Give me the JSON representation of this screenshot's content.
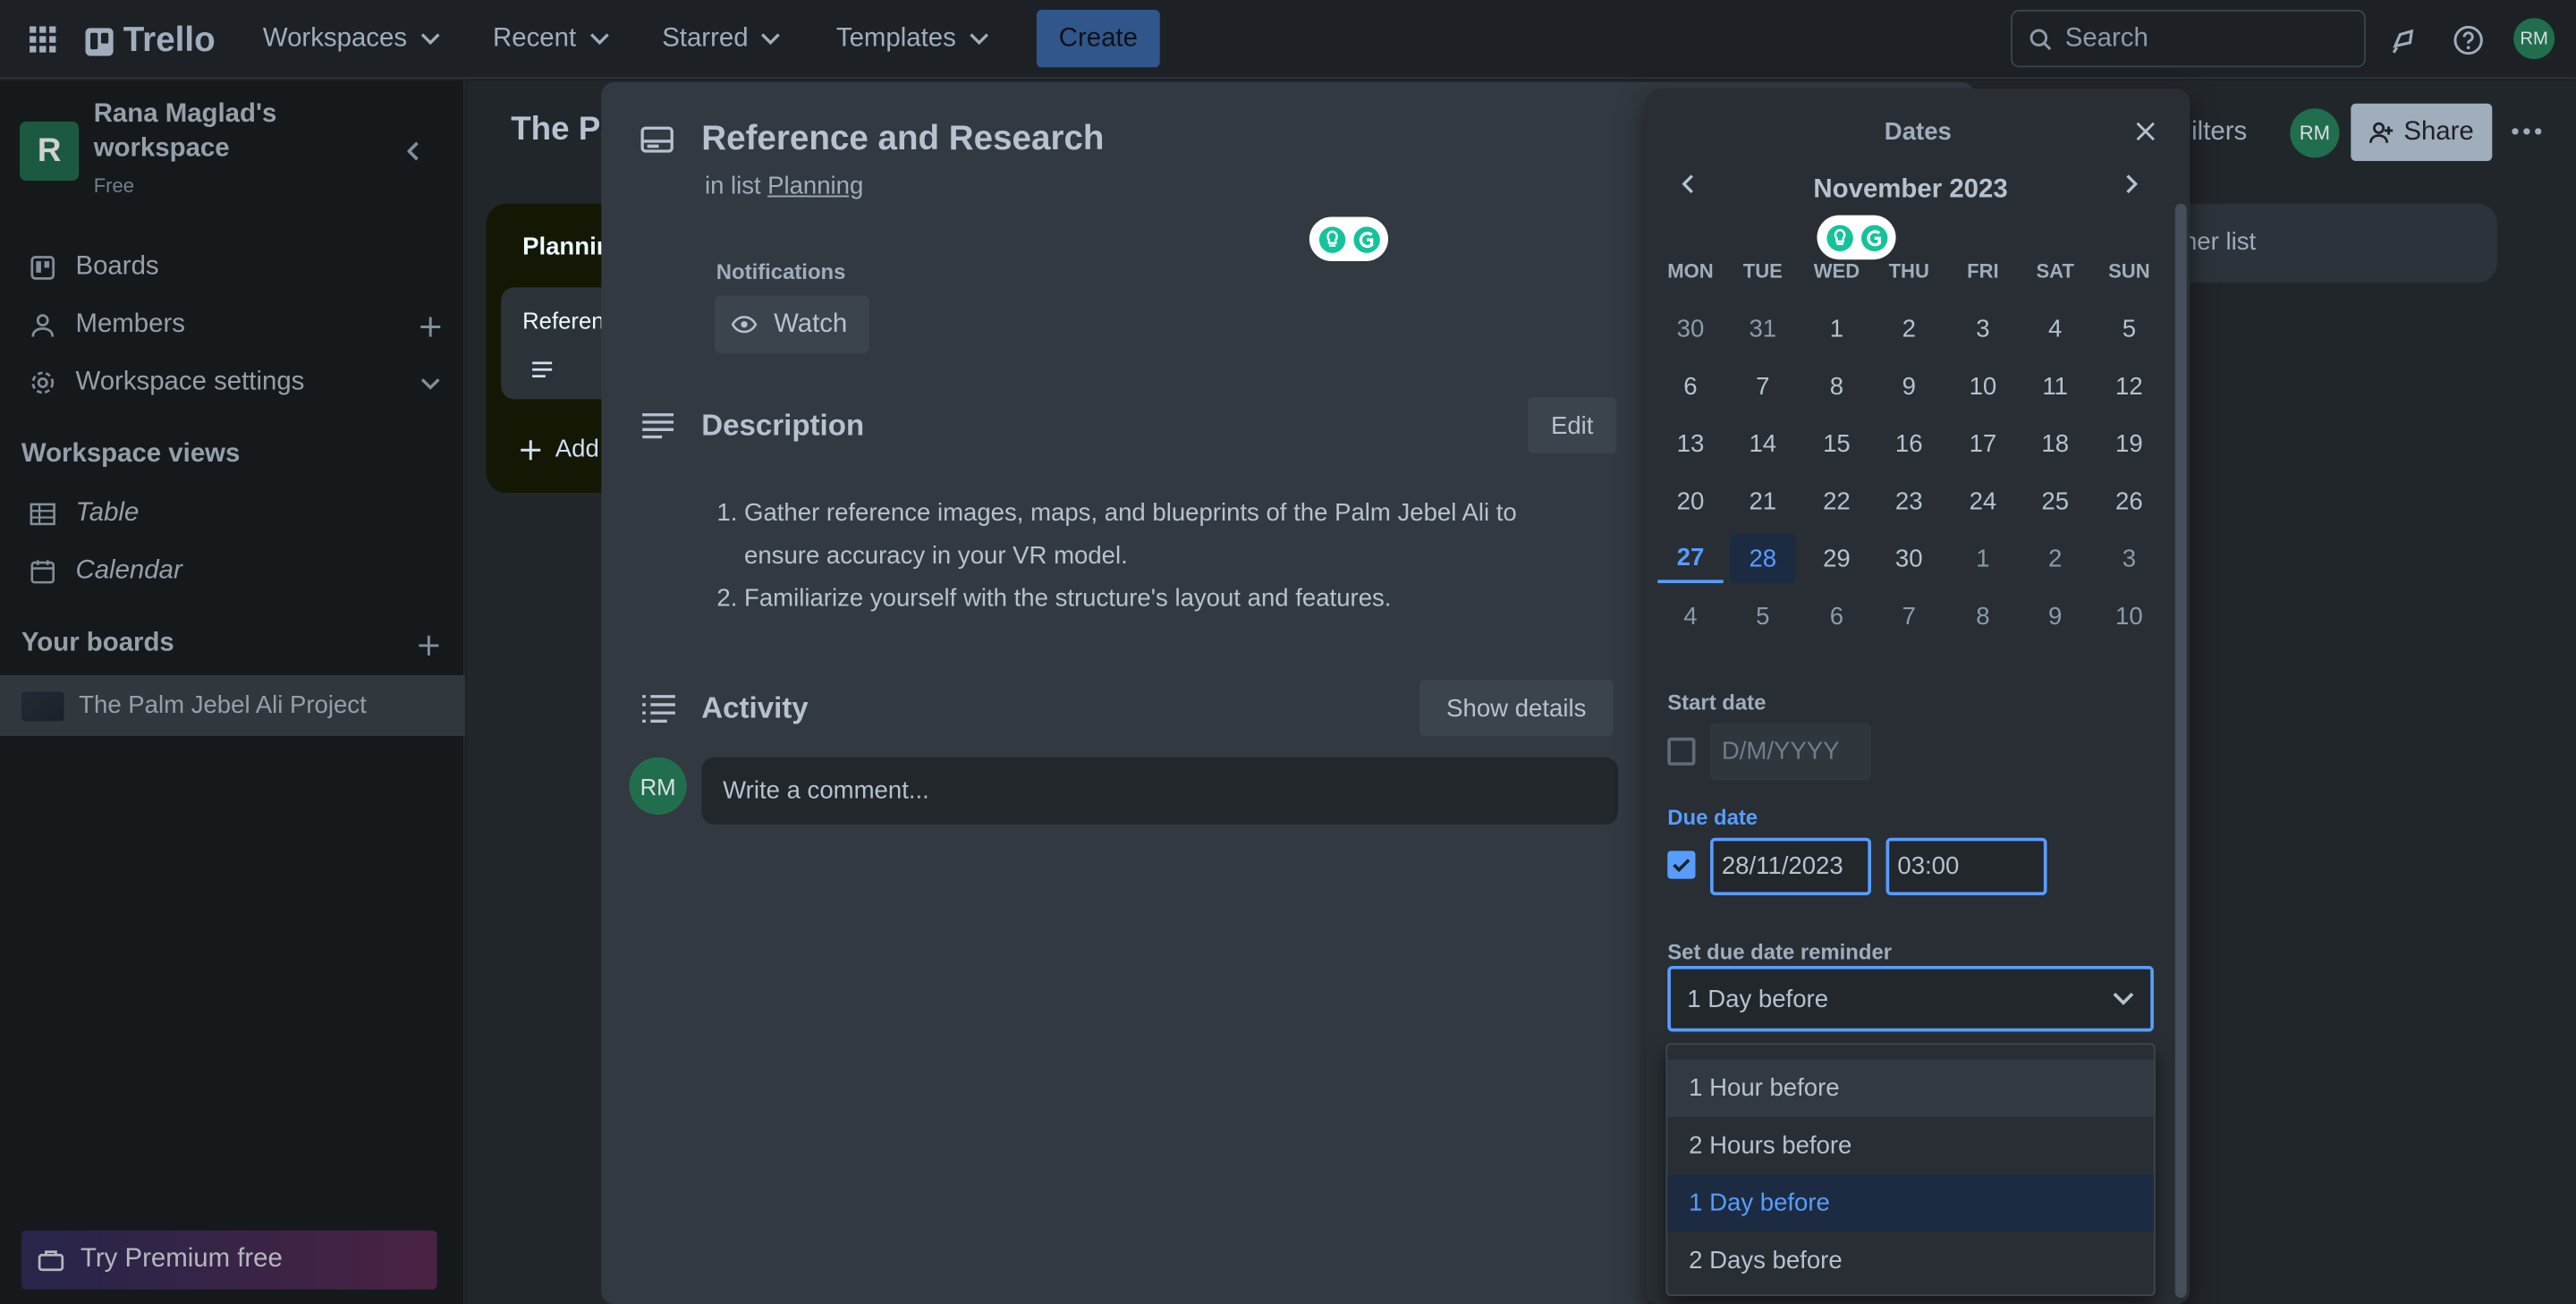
{
  "topbar": {
    "app_name": "Trello",
    "nav": [
      "Workspaces",
      "Recent",
      "Starred",
      "Templates"
    ],
    "create_label": "Create",
    "search_placeholder": "Search",
    "avatar_initials": "RM"
  },
  "sidebar": {
    "workspace_letter": "R",
    "workspace_name": "Rana Maglad's workspace",
    "plan": "Free",
    "items": [
      {
        "label": "Boards"
      },
      {
        "label": "Members"
      },
      {
        "label": "Workspace settings"
      }
    ],
    "views_heading": "Workspace views",
    "views": [
      {
        "label": "Table"
      },
      {
        "label": "Calendar"
      }
    ],
    "boards_heading": "Your boards",
    "boards": [
      {
        "label": "The Palm Jebel Ali Project"
      }
    ],
    "premium_label": "Try Premium free"
  },
  "board": {
    "title_partial": "The Pa",
    "list_name_partial": "Plannin",
    "card_partial": "Referen",
    "add_card_partial": "Add",
    "filters_partial": "ilters",
    "share_label": "Share",
    "add_list_partial": "her list",
    "member_initials": "RM"
  },
  "card": {
    "title": "Reference and Research",
    "in_list_prefix": "in list",
    "list_name": "Planning",
    "notifications_label": "Notifications",
    "watch_label": "Watch",
    "description_heading": "Description",
    "edit_label": "Edit",
    "description_items": [
      "Gather reference images, maps, and blueprints of the Palm Jebel Ali to ensure accuracy in your VR model.",
      "Familiarize yourself with the structure's layout and features."
    ],
    "activity_heading": "Activity",
    "show_details_label": "Show details",
    "comment_avatar": "RM",
    "comment_placeholder": "Write a comment..."
  },
  "dates": {
    "title": "Dates",
    "month": "November 2023",
    "weekdays": [
      "MON",
      "TUE",
      "WED",
      "THU",
      "FRI",
      "SAT",
      "SUN"
    ],
    "weeks": [
      [
        "30",
        "31",
        "1",
        "2",
        "3",
        "4",
        "5"
      ],
      [
        "6",
        "7",
        "8",
        "9",
        "10",
        "11",
        "12"
      ],
      [
        "13",
        "14",
        "15",
        "16",
        "17",
        "18",
        "19"
      ],
      [
        "20",
        "21",
        "22",
        "23",
        "24",
        "25",
        "26"
      ],
      [
        "27",
        "28",
        "29",
        "30",
        "1",
        "2",
        "3"
      ],
      [
        "4",
        "5",
        "6",
        "7",
        "8",
        "9",
        "10"
      ]
    ],
    "today": "27",
    "selected": "28",
    "start_date_label": "Start date",
    "start_date_placeholder": "D/M/YYYY",
    "due_date_label": "Due date",
    "due_date_value": "28/11/2023",
    "due_time_value": "03:00",
    "reminder_label": "Set due date reminder",
    "reminder_value": "1 Day before",
    "reminder_options": [
      "1 Hour before",
      "2 Hours before",
      "1 Day before",
      "2 Days before"
    ]
  },
  "colors": {
    "accent": "#579dff",
    "avatar_green": "#216e4e",
    "grammarly": "#15c39a"
  }
}
